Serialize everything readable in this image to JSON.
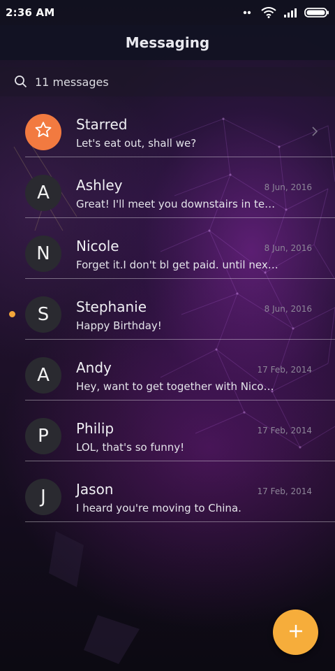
{
  "status_bar": {
    "time": "2:36 AM",
    "icons": [
      "signal-dots-icon",
      "wifi-icon",
      "cellular-signal-icon",
      "battery-icon"
    ]
  },
  "header": {
    "title": "Messaging"
  },
  "search": {
    "icon": "search-icon",
    "label": "11 messages"
  },
  "threads": [
    {
      "kind": "starred",
      "icon": "star-icon",
      "name": "Starred",
      "snippet": "Let's eat out, shall we?",
      "date": "",
      "unread": false
    },
    {
      "initial": "A",
      "name": "Ashley",
      "snippet": "Great! I'll meet you downstairs in te…",
      "date": "8 Jun, 2016",
      "unread": false
    },
    {
      "initial": "N",
      "name": "Nicole",
      "snippet": "Forget it.I don't bl get paid. until nex…",
      "date": "8 Jun, 2016",
      "unread": false
    },
    {
      "initial": "S",
      "name": "Stephanie",
      "snippet": "Happy Birthday!",
      "date": "8 Jun, 2016",
      "unread": true
    },
    {
      "initial": "A",
      "name": "Andy",
      "snippet": "Hey, want to get together with Nico…",
      "date": "17 Feb, 2014",
      "unread": false
    },
    {
      "initial": "P",
      "name": "Philip",
      "snippet": "LOL, that's so funny!",
      "date": "17 Feb, 2014",
      "unread": false
    },
    {
      "initial": "J",
      "name": "Jason",
      "snippet": "I heard you're moving to China.",
      "date": "17 Feb, 2014",
      "unread": false
    }
  ],
  "fab": {
    "icon": "plus-icon"
  },
  "colors": {
    "accent": "#f6ad3b",
    "starred_avatar": "#f27a40",
    "unread_dot": "#f4a63a",
    "avatar_bg": "#2a2a30"
  }
}
